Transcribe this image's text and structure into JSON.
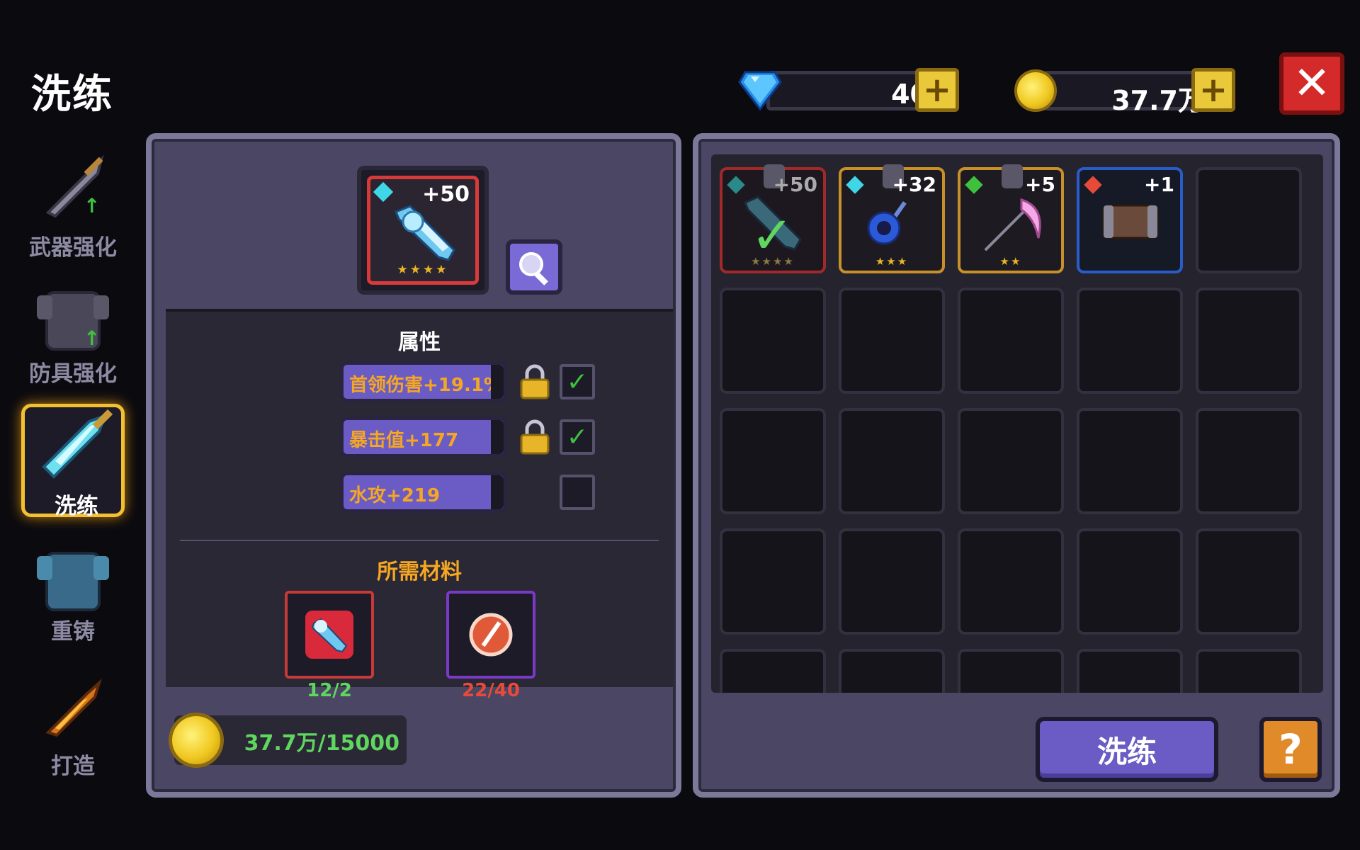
{
  "header": {
    "title": "洗练"
  },
  "currency": {
    "gems": "40",
    "gold": "37.7万"
  },
  "sidebar": {
    "items": [
      {
        "label": "武器强化",
        "active": false
      },
      {
        "label": "防具强化",
        "active": false
      },
      {
        "label": "洗练",
        "active": true
      },
      {
        "label": "重铸",
        "active": false
      },
      {
        "label": "打造",
        "active": false
      }
    ]
  },
  "equipment": {
    "level": "+50",
    "stars": "★★★★"
  },
  "attributes": {
    "title": "属性",
    "rows": [
      {
        "text": "首领伤害+19.1%",
        "locked": true,
        "checked": true
      },
      {
        "text": "暴击值+177",
        "locked": true,
        "checked": true
      },
      {
        "text": "水攻+219",
        "locked": false,
        "checked": false
      }
    ]
  },
  "materials": {
    "title": "所需材料",
    "items": [
      {
        "count": "12/2",
        "status_color": "#5fd65f"
      },
      {
        "count": "22/40",
        "status_color": "#e84a3a"
      }
    ]
  },
  "cost": {
    "text": "37.7万/15000"
  },
  "inventory": {
    "items": [
      {
        "level": "+50",
        "stars": "★★★★",
        "rarity": "red",
        "selected": true
      },
      {
        "level": "+32",
        "stars": "★★★",
        "rarity": "gold",
        "selected": false
      },
      {
        "level": "+5",
        "stars": "★★",
        "rarity": "gold",
        "selected": false
      },
      {
        "level": "+1",
        "stars": "",
        "rarity": "blue",
        "selected": false
      }
    ]
  },
  "actions": {
    "refine_label": "洗练",
    "help_label": "?"
  },
  "colors": {
    "panel": "#4a4663",
    "accent": "#6a5cc4",
    "gold": "#f0c820",
    "attr_text": "#f5a623"
  }
}
